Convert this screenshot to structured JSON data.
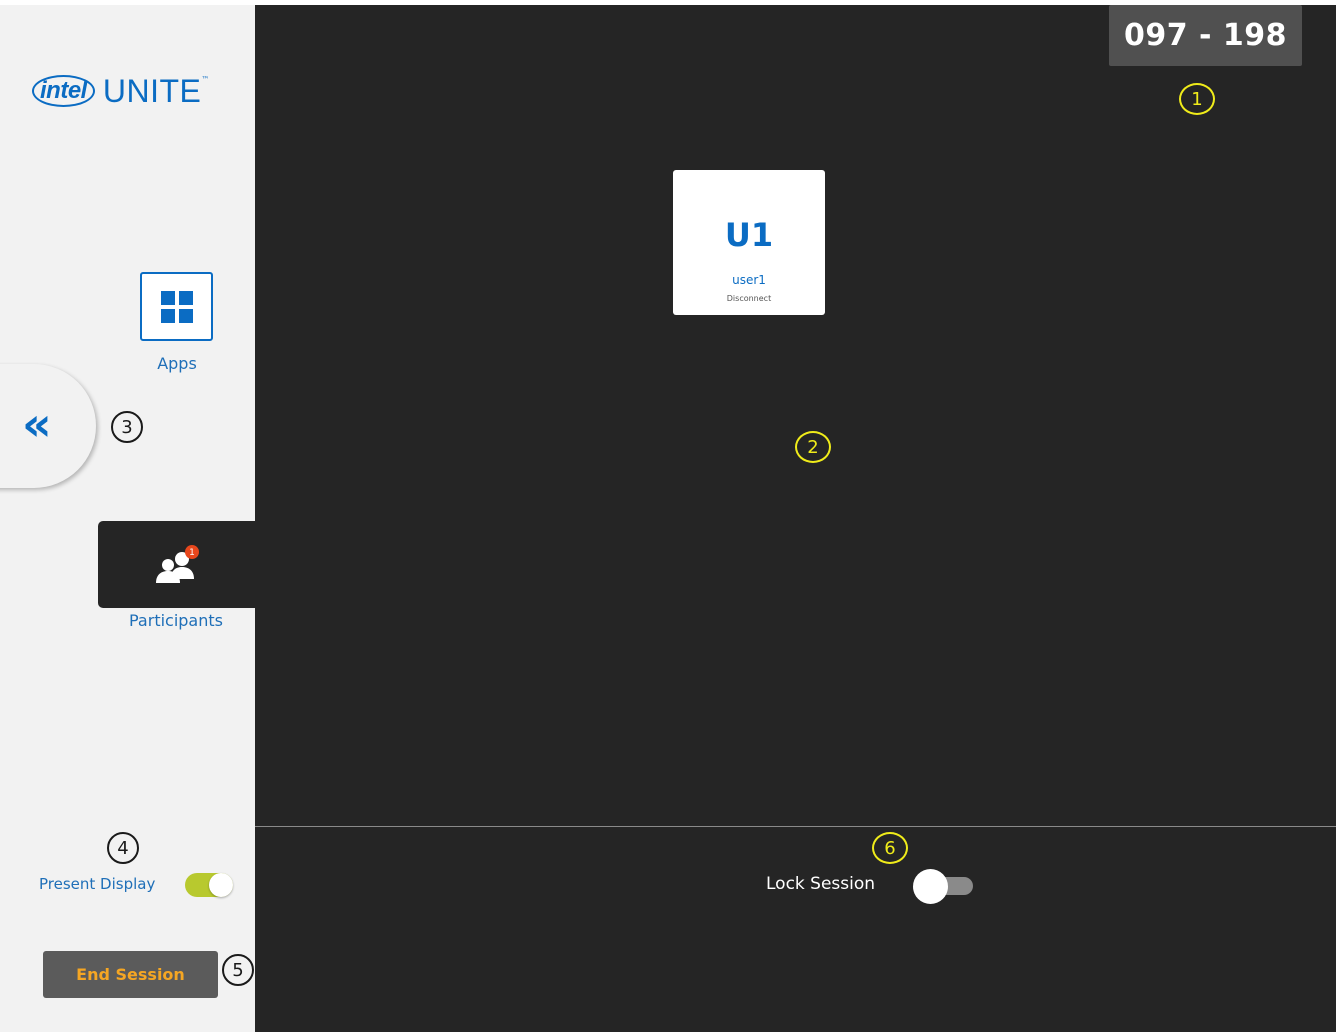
{
  "logo": {
    "intel": "intel",
    "unite": "UNITE",
    "tm": "™"
  },
  "sidebar": {
    "apps_label": "Apps",
    "collapse_glyph": "«",
    "participants_label": "Participants",
    "participants_badge": "1",
    "present_display_label": "Present Display",
    "present_display_on": true,
    "end_session_label": "End Session"
  },
  "main": {
    "session_code": "097 - 198",
    "user_card": {
      "initials": "U1",
      "name": "user1",
      "action": "Disconnect"
    },
    "lock_session_label": "Lock Session",
    "lock_session_on": false
  },
  "markers": [
    "1",
    "2",
    "3",
    "4",
    "5",
    "6"
  ],
  "colors": {
    "accent": "#0b6cc3",
    "toggle_on": "#b8c92e",
    "end_session_text": "#f5a623",
    "marker_yellow": "#f0ec1a",
    "badge": "#e8471c"
  }
}
